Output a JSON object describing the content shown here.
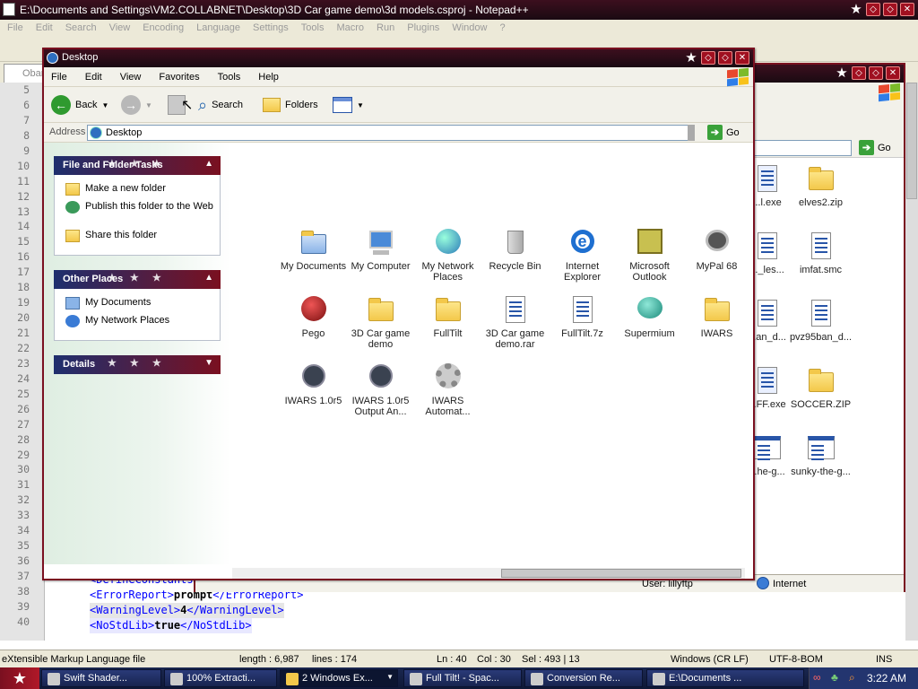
{
  "notepad": {
    "title": "E:\\Documents and Settings\\VM2.COLLABNET\\Desktop\\3D Car game demo\\3d models.csproj - Notepad++",
    "menu": [
      "File",
      "Edit",
      "Search",
      "View",
      "Encoding",
      "Language",
      "Settings",
      "Tools",
      "Macro",
      "Run",
      "Plugins",
      "Window",
      "?"
    ],
    "tab_label": "Obar",
    "line_numbers": [
      "5",
      "6",
      "7",
      "8",
      "9",
      "10",
      "11",
      "12",
      "13",
      "14",
      "15",
      "16",
      "17",
      "18",
      "19",
      "20",
      "21",
      "22",
      "23",
      "24",
      "25",
      "26",
      "27",
      "28",
      "29",
      "30",
      "31",
      "32",
      "33",
      "34",
      "35",
      "36",
      "37",
      "38",
      "39",
      "40"
    ],
    "code_lines": [
      {
        "open": "<DefineConstants>",
        "value": "",
        "close": ""
      },
      {
        "open": "<ErrorReport>",
        "value": "prompt",
        "close": "</ErrorReport>"
      },
      {
        "open": "<WarningLevel>",
        "value": "4",
        "close": "</WarningLevel>"
      },
      {
        "open": "<NoStdLib>",
        "value": "true",
        "close": "</NoStdLib>"
      }
    ],
    "status": {
      "file_type": "eXtensible Markup Language file",
      "length": "length : 6,987",
      "lines": "lines : 174",
      "ln": "Ln : 40",
      "col": "Col : 30",
      "sel": "Sel : 493 | 13",
      "eol": "Windows (CR LF)",
      "encoding": "UTF-8-BOM",
      "mode": "INS"
    }
  },
  "explorer2": {
    "go": "Go",
    "user": "User: lillyftp",
    "zone": "Internet",
    "files": [
      {
        "label": "...l.exe",
        "icon": "exe-icon"
      },
      {
        "label": "elves2.zip",
        "icon": "zip-folder-icon"
      },
      {
        "label": "..._les...",
        "icon": "file-icon"
      },
      {
        "label": "imfat.smc",
        "icon": "file-icon"
      },
      {
        "label": "...an_d...",
        "icon": "file-icon"
      },
      {
        "label": "pvz95ban_d...",
        "icon": "file-icon"
      },
      {
        "label": "...FF.exe",
        "icon": "exe-icon"
      },
      {
        "label": "SOCCER.ZIP",
        "icon": "zip-folder-icon"
      },
      {
        "label": "...he-g...",
        "icon": "window-icon"
      },
      {
        "label": "sunky-the-g...",
        "icon": "window-icon"
      }
    ]
  },
  "window": {
    "title": "Desktop",
    "menu": [
      "File",
      "Edit",
      "View",
      "Favorites",
      "Tools",
      "Help"
    ],
    "toolbar": {
      "back": "Back",
      "search": "Search",
      "folders": "Folders"
    },
    "address_label": "Address",
    "address_value": "Desktop",
    "go": "Go"
  },
  "tasks": {
    "file_folder": {
      "title": "File and Folder Tasks",
      "items": [
        "Make a new folder",
        "Publish this folder to the Web",
        "Share this folder"
      ]
    },
    "other_places": {
      "title": "Other Places",
      "items": [
        "My Documents",
        "My Network Places"
      ]
    },
    "details": {
      "title": "Details"
    }
  },
  "desktop_icons": [
    {
      "label": "My Documents",
      "icon": "my-documents-icon"
    },
    {
      "label": "My Computer",
      "icon": "my-computer-icon"
    },
    {
      "label": "My Network Places",
      "icon": "network-places-icon"
    },
    {
      "label": "Recycle Bin",
      "icon": "recycle-bin-icon"
    },
    {
      "label": "Internet Explorer",
      "icon": "internet-explorer-icon"
    },
    {
      "label": "Microsoft Outlook",
      "icon": "outlook-icon"
    },
    {
      "label": "MyPal 68",
      "icon": "mypal-icon"
    },
    {
      "label": "Pego",
      "icon": "pego-icon"
    },
    {
      "label": "3D Car game demo",
      "icon": "folder-icon"
    },
    {
      "label": "FullTilt",
      "icon": "folder-icon"
    },
    {
      "label": "3D Car game demo.rar",
      "icon": "rar-file-icon"
    },
    {
      "label": "FullTilt.7z",
      "icon": "archive-file-icon"
    },
    {
      "label": "Supermium",
      "icon": "supermium-icon"
    },
    {
      "label": "IWARS",
      "icon": "folder-icon"
    },
    {
      "label": "IWARS 1.0r5",
      "icon": "iwars-icon"
    },
    {
      "label": "IWARS 1.0r5 Output An...",
      "icon": "iwars-icon"
    },
    {
      "label": "IWARS Automat...",
      "icon": "gear-icon"
    }
  ],
  "taskbar": {
    "items": [
      {
        "label": "Swift Shader..."
      },
      {
        "label": "100% Extracti..."
      },
      {
        "label": "2 Windows Ex..."
      },
      {
        "label": "Full Tilt! - Spac..."
      },
      {
        "label": "Conversion Re..."
      },
      {
        "label": "E:\\Documents ..."
      }
    ],
    "clock": "3:22 AM"
  }
}
